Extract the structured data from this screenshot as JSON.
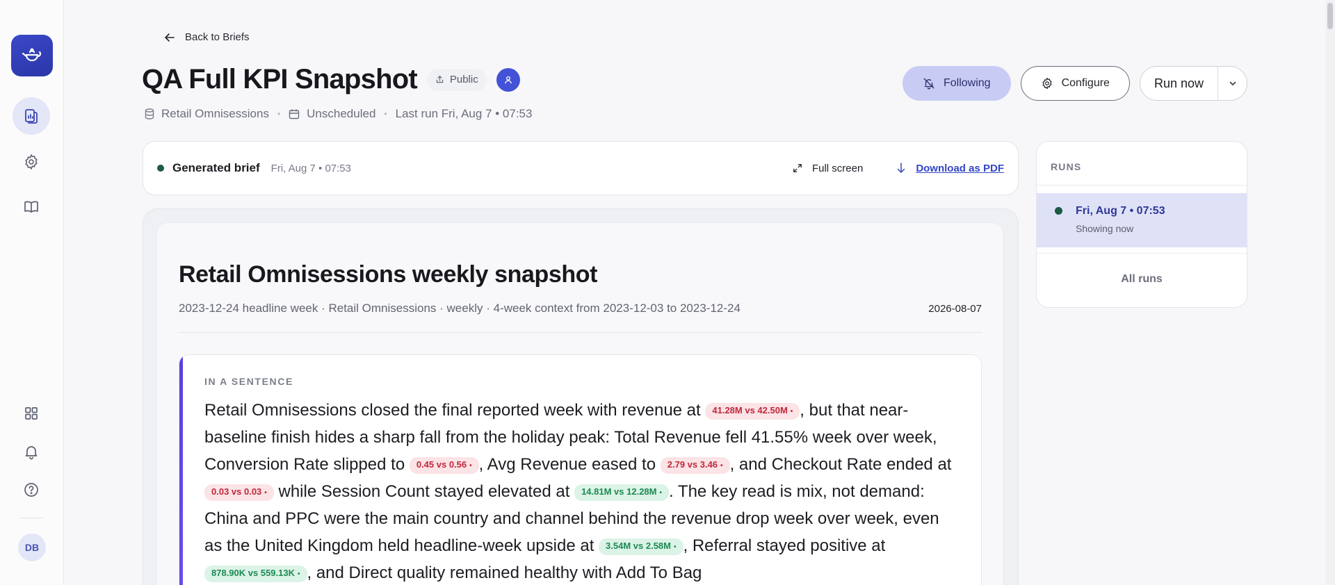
{
  "sidebar": {
    "logo_icon": "teapot-icon",
    "items": [
      {
        "name": "briefs",
        "icon": "document-chart-icon",
        "active": true
      },
      {
        "name": "settings",
        "icon": "gear-icon",
        "active": false
      },
      {
        "name": "docs",
        "icon": "book-icon",
        "active": false
      },
      {
        "name": "apps",
        "icon": "grid-icon",
        "active": false
      },
      {
        "name": "notifications",
        "icon": "bell-icon",
        "active": false
      },
      {
        "name": "help",
        "icon": "help-circle-icon",
        "active": false
      }
    ],
    "avatar_initials": "DB"
  },
  "header": {
    "back_label": "Back to Briefs",
    "title": "QA Full KPI Snapshot",
    "visibility": "Public",
    "dataset": "Retail Omnisessions",
    "schedule": "Unscheduled",
    "last_run": "Last run Fri, Aug 7 • 07:53",
    "following_label": "Following",
    "configure_label": "Configure",
    "run_now_label": "Run now"
  },
  "brief_bar": {
    "status_label": "Generated brief",
    "timestamp": "Fri, Aug 7 • 07:53",
    "fullscreen_label": "Full screen",
    "download_label": "Download as PDF"
  },
  "document": {
    "title": "Retail Omnisessions weekly snapshot",
    "subtitle": "2023-12-24 headline week · Retail Omnisessions · weekly · 4-week context from 2023-12-03 to 2023-12-24",
    "date": "2026-08-07",
    "sentence_label": "IN A SENTENCE",
    "sentence": {
      "t1": "Retail Omnisessions closed the final reported week with revenue at ",
      "c1": "41.28M vs 42.50M",
      "t2": ", but that near-baseline finish hides a sharp fall from the holiday peak: Total Revenue fell 41.55% week over week, Conversion Rate slipped to ",
      "c2": "0.45 vs 0.56",
      "t3": ", Avg Revenue eased to ",
      "c3": "2.79 vs 3.46",
      "t4": ", and Checkout Rate ended at ",
      "c4": "0.03 vs 0.03",
      "t5": " while Session Count stayed elevated at ",
      "c5": "14.81M vs 12.28M",
      "t6": ". The key read is mix, not demand: China and PPC were the main country and channel behind the revenue drop week over week, even as the United Kingdom held headline-week upside at ",
      "c6": "3.54M vs 2.58M",
      "t7": ", Referral stayed positive at ",
      "c7": "878.90K vs 559.13K",
      "t8": ", and Direct quality remained healthy with Add To Bag"
    },
    "chip_dot": "•"
  },
  "runs": {
    "label": "RUNS",
    "items": [
      {
        "time": "Fri, Aug 7 • 07:53",
        "note": "Showing now"
      }
    ],
    "all_runs_label": "All runs"
  },
  "colors": {
    "accent": "#3b48c8",
    "negative": "#c0283b",
    "positive": "#1c8a52",
    "status_dot": "#1c5a45"
  }
}
